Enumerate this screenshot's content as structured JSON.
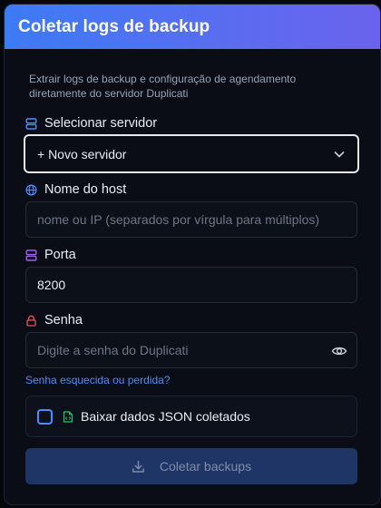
{
  "dialog": {
    "title": "Coletar logs de backup",
    "description": "Extrair logs de backup e configuração de agendamento diretamente do servidor Duplicati"
  },
  "server": {
    "label": "Selecionar servidor",
    "selected": "+ Novo servidor",
    "icon": "server-icon"
  },
  "hostname": {
    "label": "Nome do host",
    "placeholder": "nome ou IP (separados por vírgula para múltiplos)",
    "value": "",
    "icon": "globe-icon"
  },
  "port": {
    "label": "Porta",
    "value": "8200",
    "icon": "server-icon"
  },
  "password": {
    "label": "Senha",
    "placeholder": "Digite a senha do Duplicati",
    "value": "",
    "icon": "lock-icon"
  },
  "forgot_password": "Senha esquecida ou perdida?",
  "download_json": {
    "label": "Baixar dados JSON coletados",
    "checked": false
  },
  "submit": {
    "label": "Coletar backups"
  },
  "colors": {
    "header_start": "#3d7bf5",
    "header_end": "#6b62ee",
    "accent": "#4a8dff",
    "button_bg": "#1e3566"
  }
}
